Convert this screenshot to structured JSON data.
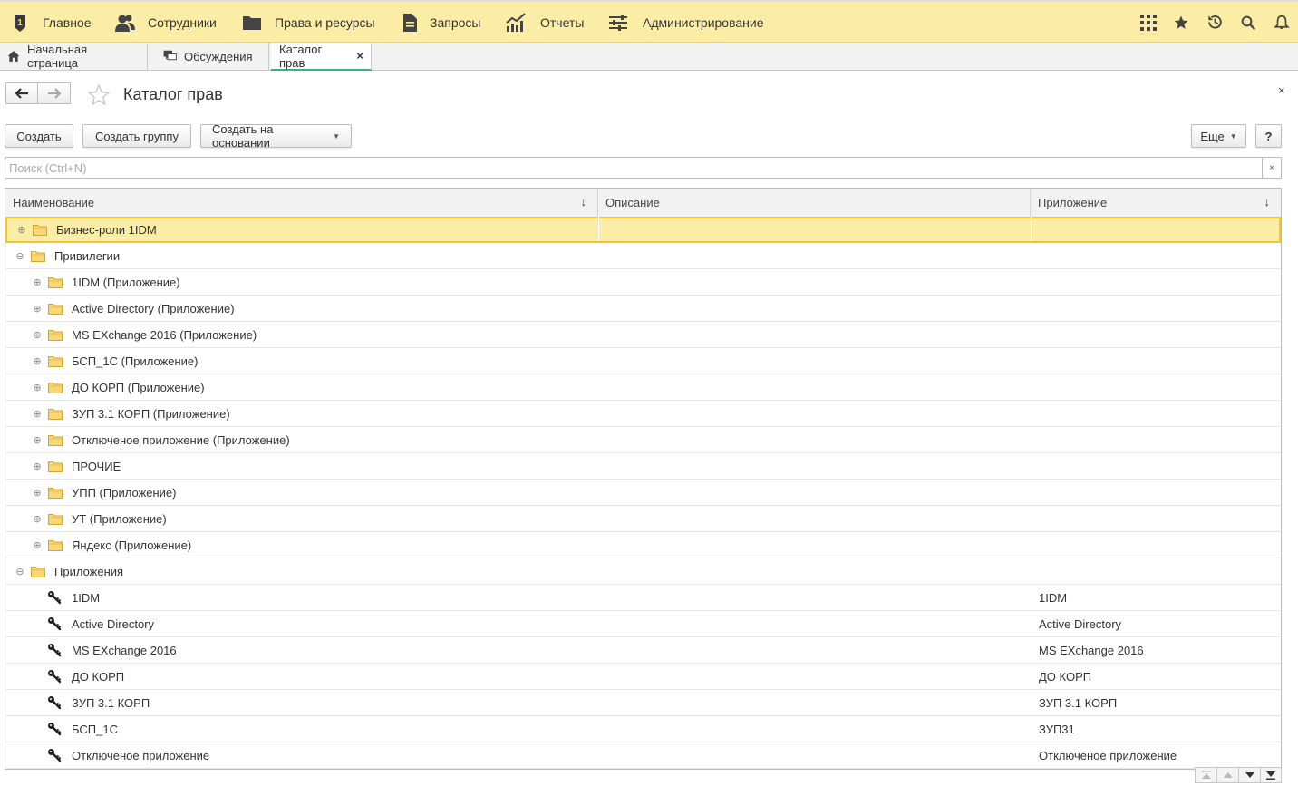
{
  "sections": {
    "items": [
      {
        "label": "Главное",
        "icon": "logo-1c-icon"
      },
      {
        "label": "Сотрудники",
        "icon": "users-icon"
      },
      {
        "label": "Права и ресурсы",
        "icon": "folder-icon"
      },
      {
        "label": "Запросы",
        "icon": "document-icon"
      },
      {
        "label": "Отчеты",
        "icon": "chart-icon"
      },
      {
        "label": "Администрирование",
        "icon": "settings-sliders-icon"
      }
    ],
    "right_icons": [
      "grid-menu-icon",
      "star-icon",
      "history-icon",
      "search-icon",
      "bell-icon"
    ]
  },
  "tabs": [
    {
      "label": "Начальная страница",
      "icon": "home-icon"
    },
    {
      "label": "Обсуждения",
      "icon": "discussions-icon"
    },
    {
      "label": "Каталог прав",
      "close": "×"
    }
  ],
  "form": {
    "title": "Каталог прав",
    "close": "×"
  },
  "commands": {
    "create": "Создать",
    "create_group": "Создать группу",
    "create_based_on": "Создать на основании",
    "more": "Еще",
    "help": "?"
  },
  "search": {
    "placeholder": "Поиск (Ctrl+N)",
    "value": "",
    "clear": "×"
  },
  "table": {
    "columns": [
      {
        "label": "Наименование",
        "sort": "↓"
      },
      {
        "label": "Описание",
        "sort": ""
      },
      {
        "label": "Приложение",
        "sort": "↓"
      }
    ],
    "rows": [
      {
        "name": "Бизнес-роли 1IDM",
        "description": "",
        "app": "",
        "level": 0,
        "kind": "folder",
        "toggle": "⊕",
        "selected": true
      },
      {
        "name": "Привилегии",
        "description": "",
        "app": "",
        "level": 0,
        "kind": "folder",
        "toggle": "⊖"
      },
      {
        "name": "1IDM (Приложение)",
        "description": "",
        "app": "",
        "level": 1,
        "kind": "folder",
        "toggle": "⊕"
      },
      {
        "name": "Active Directory (Приложение)",
        "description": "",
        "app": "",
        "level": 1,
        "kind": "folder",
        "toggle": "⊕"
      },
      {
        "name": "MS EXchange 2016 (Приложение)",
        "description": "",
        "app": "",
        "level": 1,
        "kind": "folder",
        "toggle": "⊕"
      },
      {
        "name": "БСП_1С (Приложение)",
        "description": "",
        "app": "",
        "level": 1,
        "kind": "folder",
        "toggle": "⊕"
      },
      {
        "name": "ДО КОРП (Приложение)",
        "description": "",
        "app": "",
        "level": 1,
        "kind": "folder",
        "toggle": "⊕"
      },
      {
        "name": "ЗУП 3.1 КОРП (Приложение)",
        "description": "",
        "app": "",
        "level": 1,
        "kind": "folder",
        "toggle": "⊕"
      },
      {
        "name": "Отключеное приложение (Приложение)",
        "description": "",
        "app": "",
        "level": 1,
        "kind": "folder",
        "toggle": "⊕"
      },
      {
        "name": "ПРОЧИЕ",
        "description": "",
        "app": "",
        "level": 1,
        "kind": "folder",
        "toggle": "⊕"
      },
      {
        "name": "УПП (Приложение)",
        "description": "",
        "app": "",
        "level": 1,
        "kind": "folder",
        "toggle": "⊕"
      },
      {
        "name": "УТ (Приложение)",
        "description": "",
        "app": "",
        "level": 1,
        "kind": "folder",
        "toggle": "⊕"
      },
      {
        "name": "Яндекс (Приложение)",
        "description": "",
        "app": "",
        "level": 1,
        "kind": "folder",
        "toggle": "⊕"
      },
      {
        "name": "Приложения",
        "description": "",
        "app": "",
        "level": 0,
        "kind": "folder",
        "toggle": "⊖"
      },
      {
        "name": "1IDM",
        "description": "",
        "app": "1IDM",
        "level": 1,
        "kind": "key"
      },
      {
        "name": "Active Directory",
        "description": "",
        "app": "Active Directory",
        "level": 1,
        "kind": "key"
      },
      {
        "name": "MS EXchange 2016",
        "description": "",
        "app": "MS EXchange 2016",
        "level": 1,
        "kind": "key"
      },
      {
        "name": "ДО КОРП",
        "description": "",
        "app": "ДО КОРП",
        "level": 1,
        "kind": "key"
      },
      {
        "name": "ЗУП 3.1 КОРП",
        "description": "",
        "app": "ЗУП 3.1 КОРП",
        "level": 1,
        "kind": "key"
      },
      {
        "name": "БСП_1С",
        "description": "",
        "app": "ЗУП31",
        "level": 1,
        "kind": "key"
      },
      {
        "name": "Отключеное приложение",
        "description": "",
        "app": "Отключеное приложение",
        "level": 1,
        "kind": "key"
      }
    ]
  },
  "colors": {
    "section_bar": "#fbeda6",
    "selection": "#fbeda6",
    "selection_border": "#f4c430",
    "active_tab_underline": "#3cb371"
  }
}
